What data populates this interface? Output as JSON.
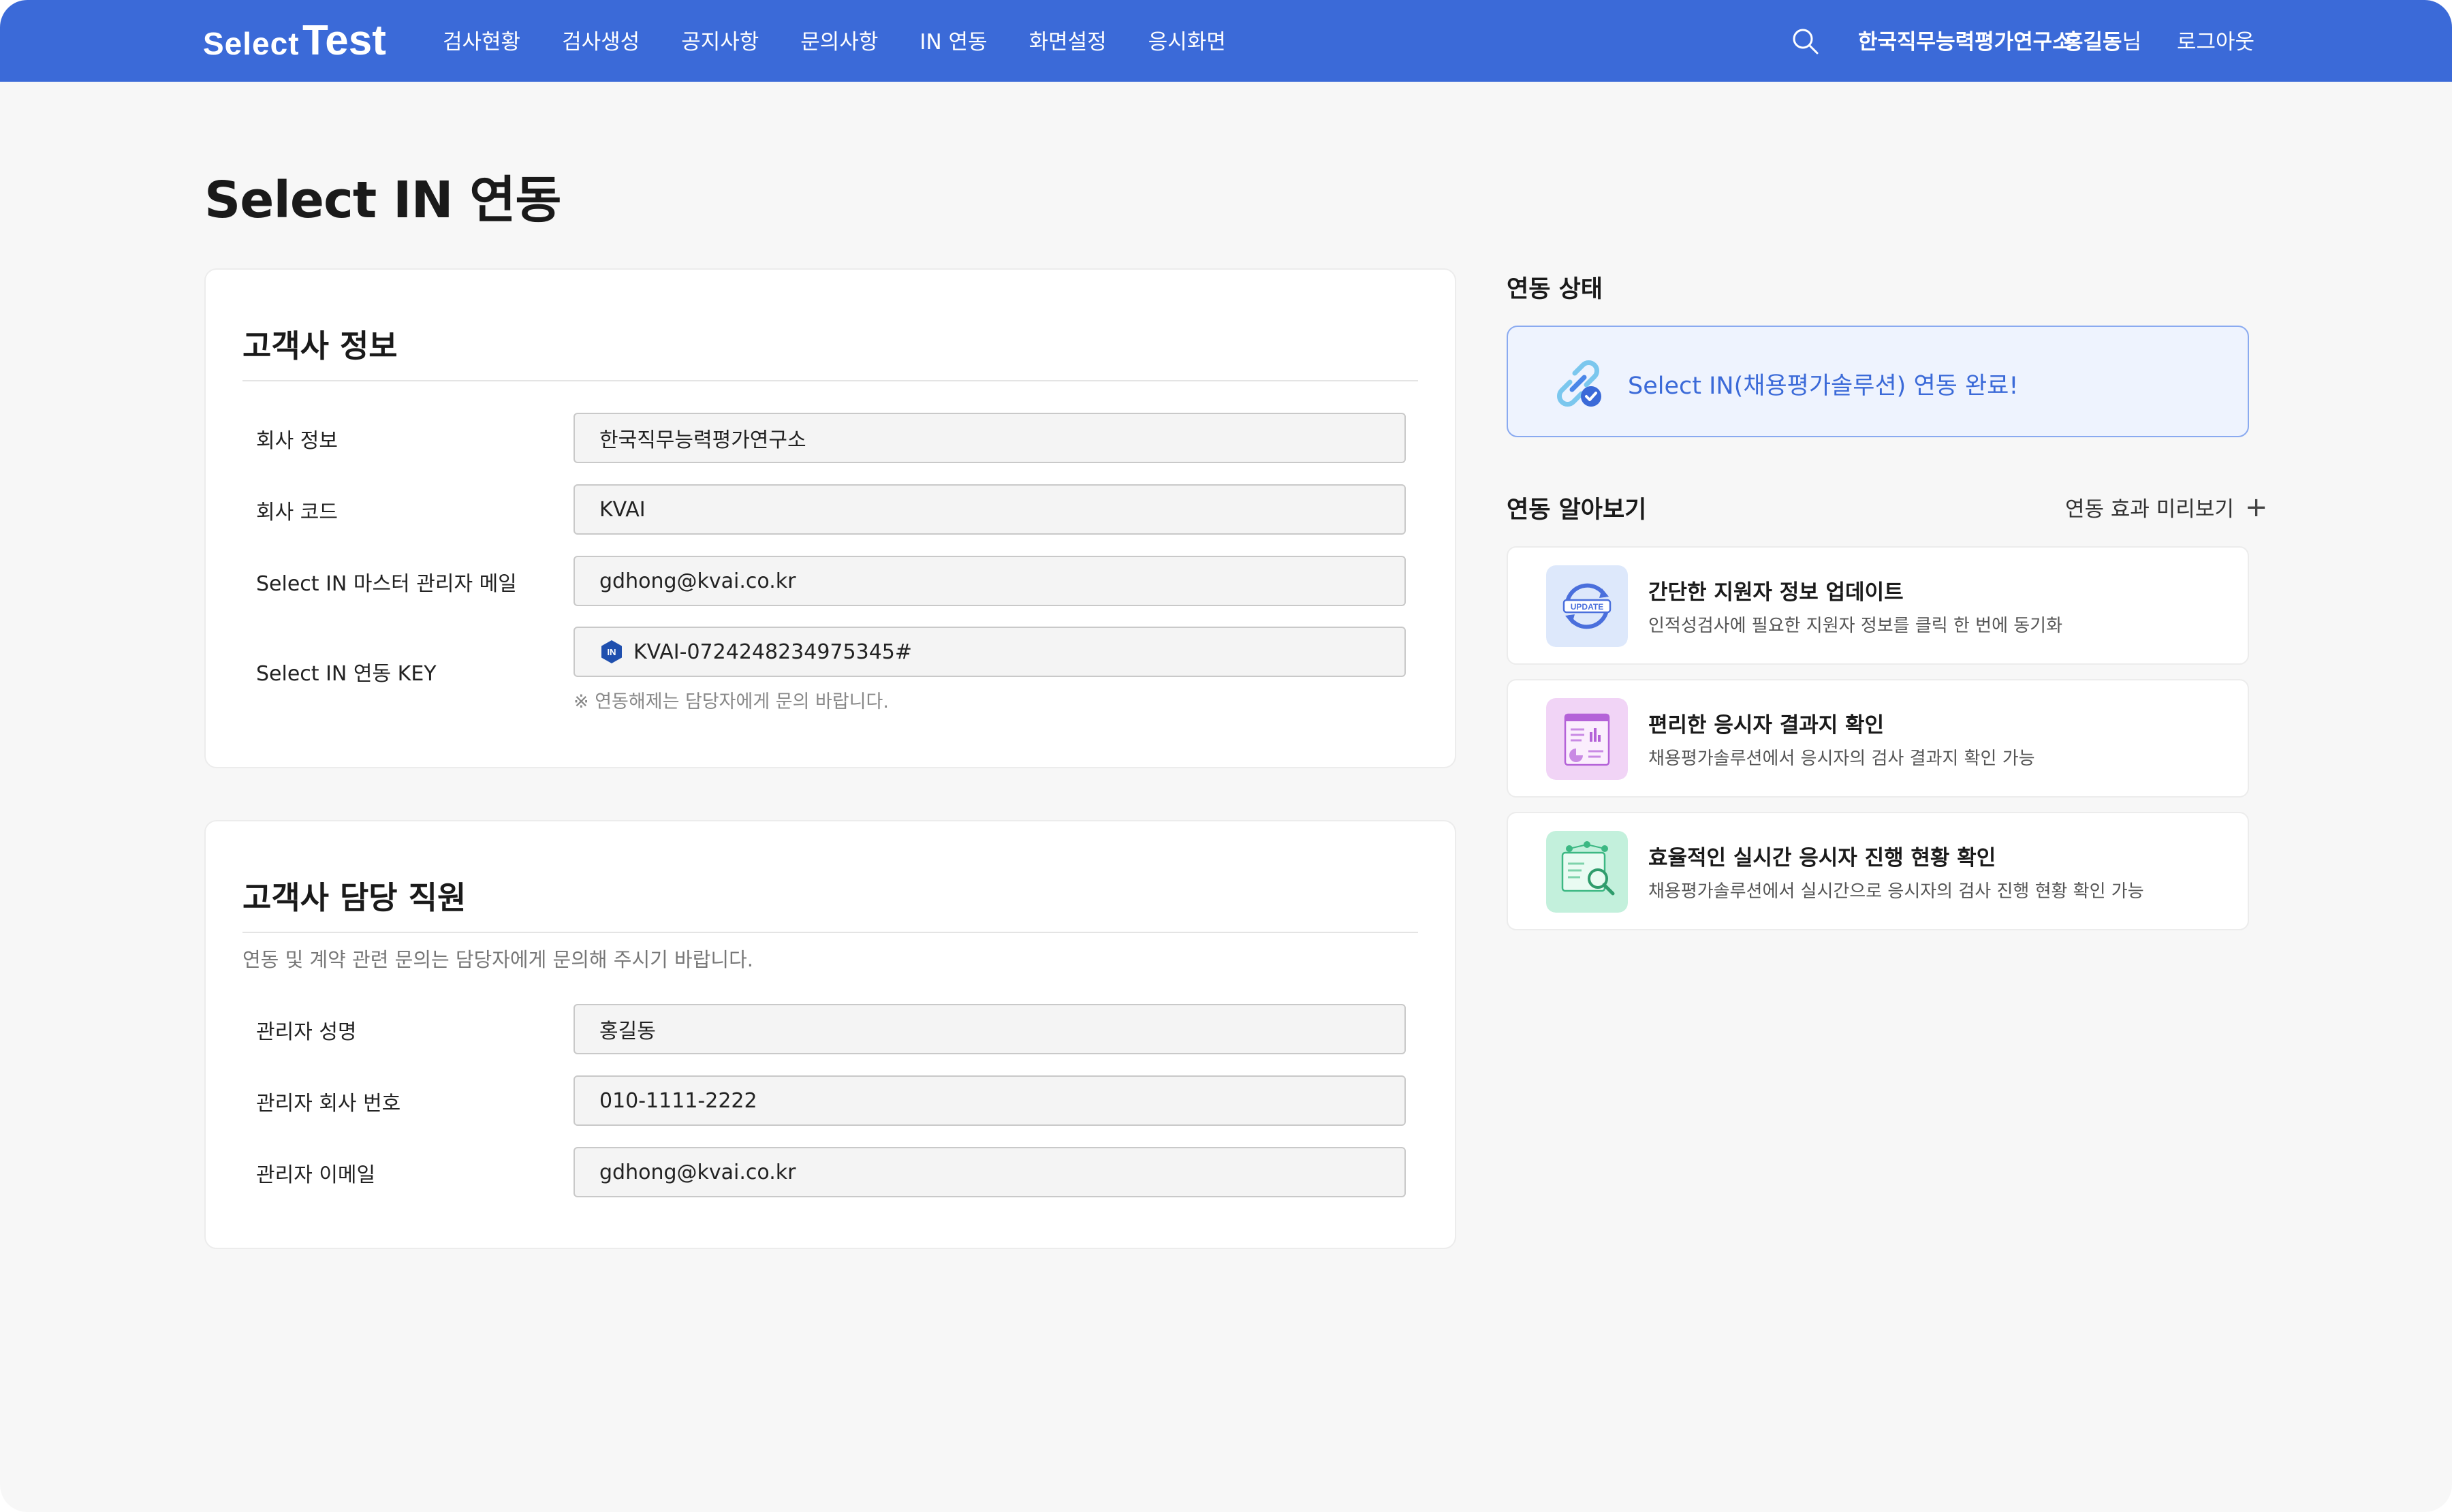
{
  "header": {
    "logo_part1": "Select",
    "logo_part2": "Test",
    "nav": [
      "검사현황",
      "검사생성",
      "공지사항",
      "문의사항",
      "IN 연동",
      "화면설정",
      "응시화면"
    ],
    "org_name": "한국직무능력평가연구소",
    "user_name": "홍길동",
    "user_suffix": "님",
    "logout": "로그아웃",
    "search_icon": "search-icon"
  },
  "page": {
    "title": "Select IN 연동"
  },
  "customer_info": {
    "title": "고객사 정보",
    "rows": [
      {
        "label": "회사 정보",
        "value": "한국직무능력평가연구소"
      },
      {
        "label": "회사 코드",
        "value": "KVAI"
      },
      {
        "label": "Select IN 마스터 관리자 메일",
        "value": "gdhong@kvai.co.kr"
      },
      {
        "label": "Select IN 연동 KEY",
        "value": "KVAI-0724248234975345#"
      }
    ],
    "key_badge": "IN",
    "hint": "※ 연동해제는 담당자에게 문의 바랍니다."
  },
  "customer_staff": {
    "title": "고객사 담당 직원",
    "desc": "연동 및 계약 관련 문의는 담당자에게 문의해 주시기 바랍니다.",
    "rows": [
      {
        "label": "관리자 성명",
        "value": "홍길동"
      },
      {
        "label": "관리자 회사 번호",
        "value": "010-1111-2222"
      },
      {
        "label": "관리자 이메일",
        "value": "gdhong@kvai.co.kr"
      }
    ]
  },
  "status": {
    "title": "연동 상태",
    "message": "Select IN(채용평가솔루션) 연동 완료!",
    "icon": "link-check-icon"
  },
  "learn": {
    "title": "연동 알아보기",
    "preview_link": "연동 효과 미리보기",
    "features": [
      {
        "title": "간단한 지원자 정보 업데이트",
        "desc": "인적성검사에 필요한 지원자 정보를 클릭 한 번에 동기화",
        "icon": "update-icon",
        "icon_label": "UPDATE"
      },
      {
        "title": "편리한 응시자 결과지 확인",
        "desc": "채용평가솔루션에서 응시자의 검사 결과지 확인 가능",
        "icon": "report-icon"
      },
      {
        "title": "효율적인 실시간 응시자 진행 현황 확인",
        "desc": "채용평가솔루션에서 실시간으로 응시자의 검사 진행 현황 확인 가능",
        "icon": "monitor-search-icon"
      }
    ]
  },
  "colors": {
    "brand": "#3b6ad8",
    "background": "#f7f7f7",
    "status_bg": "#eef3fe",
    "status_border": "#8aaaf0"
  }
}
